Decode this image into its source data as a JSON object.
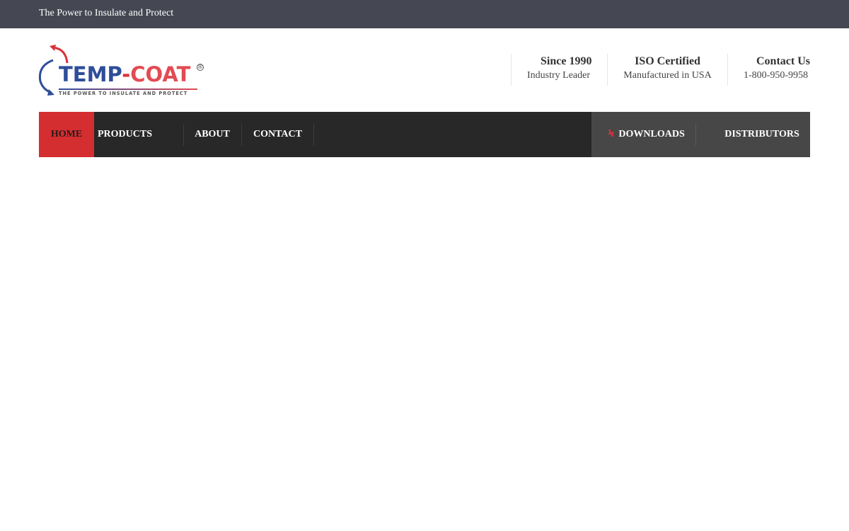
{
  "topbar": {
    "tagline": "The Power to Insulate and Protect"
  },
  "logo": {
    "word_left": "TEMP",
    "word_dash": "-",
    "word_right": "COAT",
    "registered": "®",
    "subtitle": "THE POWER TO INSULATE AND PROTECT"
  },
  "info": [
    {
      "title": "Since 1990",
      "sub": "Industry Leader"
    },
    {
      "title": "ISO Certified",
      "sub": "Manufactured in USA"
    },
    {
      "title": "Contact Us",
      "sub": "1-800-950-9958"
    }
  ],
  "nav": {
    "home": "HOME",
    "products": "PRODUCTS",
    "about": "ABOUT",
    "contact": "CONTACT",
    "downloads": "DOWNLOADS",
    "distributors": "DISTRIBUTORS",
    "downloads_icon": "lightning-bolt-icon"
  },
  "colors": {
    "topbar": "#454853",
    "nav": "#282828",
    "nav_active": "#d42e31",
    "nav_right": "#474747",
    "brand_blue": "#2e4d9a",
    "brand_red": "#d9323a"
  }
}
